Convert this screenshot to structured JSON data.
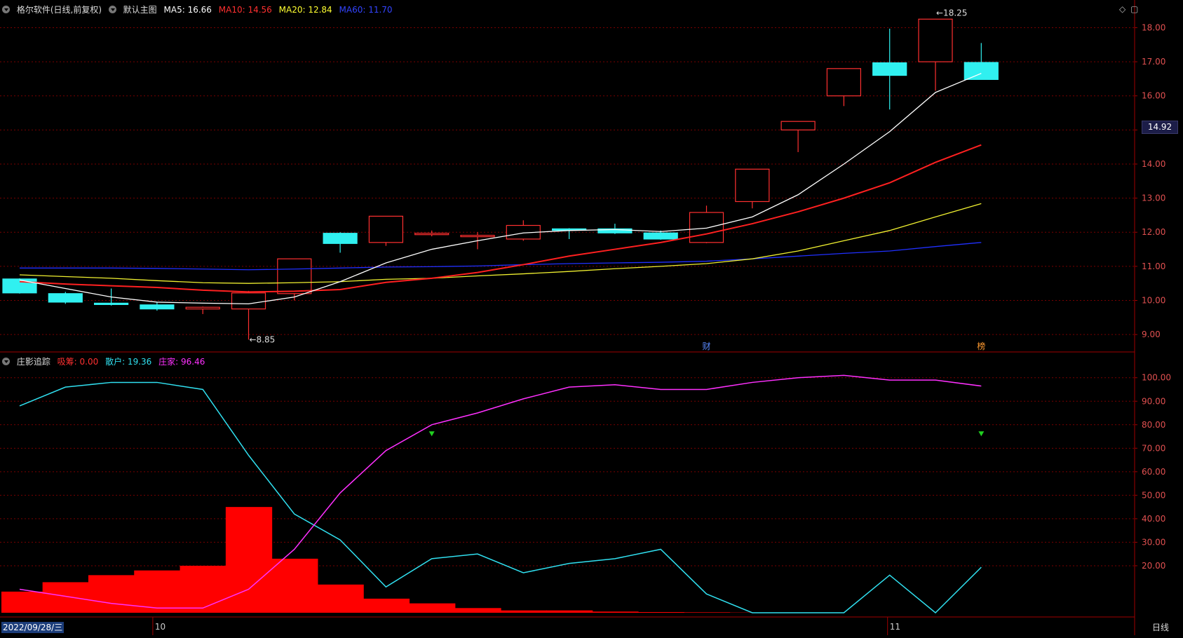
{
  "header_top": {
    "software": "格尔软件(日线,前复权)",
    "chart_name": "默认主图",
    "ma": [
      {
        "label": "MA5: 16.66",
        "color": "#ffffff"
      },
      {
        "label": "MA10: 14.56",
        "color": "#ff3030"
      },
      {
        "label": "MA20: 12.84",
        "color": "#ffff30"
      },
      {
        "label": "MA60: 11.70",
        "color": "#2233ff"
      }
    ]
  },
  "header_bottom": {
    "name": "庄影追踪",
    "items": [
      {
        "label": "吸筹: 0.00",
        "color": "#ff3030"
      },
      {
        "label": "散户: 19.36",
        "color": "#30e0f0"
      },
      {
        "label": "庄家: 96.46",
        "color": "#ff30ff"
      }
    ]
  },
  "current_price": "14.92",
  "date_label": "2022/09/28/三",
  "period_label": "日线",
  "month_marks": [
    "10",
    "11"
  ],
  "colors": {
    "up": "#ff3030",
    "down": "#30f0f0",
    "ma5": "#ffffff",
    "ma10": "#ff2020",
    "ma20": "#f0f030",
    "ma60": "#2030ff",
    "grid": "#7a0000",
    "retail": "#30e0f0",
    "banker": "#ff30ff",
    "absorb": "#ff0000",
    "signal": "#20d020"
  },
  "chart_data": [
    {
      "type": "candlestick",
      "ylim": [
        8.5,
        18.5
      ],
      "yticks": [
        "18.00",
        "17.00",
        "16.00",
        "15.00",
        "14.00",
        "13.00",
        "12.00",
        "11.00",
        "10.00",
        "9.00"
      ],
      "candles": [
        {
          "o": 10.63,
          "c": 10.22,
          "h": 10.65,
          "l": 10.2
        },
        {
          "o": 10.2,
          "c": 9.95,
          "h": 10.25,
          "l": 9.9
        },
        {
          "o": 9.92,
          "c": 9.88,
          "h": 10.35,
          "l": 9.85
        },
        {
          "o": 9.87,
          "c": 9.75,
          "h": 9.95,
          "l": 9.7
        },
        {
          "o": 9.75,
          "c": 9.8,
          "h": 9.82,
          "l": 9.6
        },
        {
          "o": 9.75,
          "c": 10.22,
          "h": 10.28,
          "l": 8.85
        },
        {
          "o": 10.2,
          "c": 11.22,
          "h": 11.22,
          "l": 10.0
        },
        {
          "o": 11.97,
          "c": 11.67,
          "h": 12.0,
          "l": 11.4
        },
        {
          "o": 11.7,
          "c": 12.47,
          "h": 12.47,
          "l": 11.6
        },
        {
          "o": 11.97,
          "c": 11.97,
          "h": 12.05,
          "l": 11.88
        },
        {
          "o": 11.9,
          "c": 11.91,
          "h": 12.0,
          "l": 11.5
        },
        {
          "o": 11.8,
          "c": 12.2,
          "h": 12.35,
          "l": 11.75
        },
        {
          "o": 12.1,
          "c": 12.08,
          "h": 12.12,
          "l": 11.8
        },
        {
          "o": 12.1,
          "c": 11.98,
          "h": 12.25,
          "l": 11.95
        },
        {
          "o": 11.98,
          "c": 11.8,
          "h": 12.05,
          "l": 11.78
        },
        {
          "o": 11.7,
          "c": 12.58,
          "h": 12.78,
          "l": 11.68
        },
        {
          "o": 12.9,
          "c": 13.85,
          "h": 13.85,
          "l": 12.7
        },
        {
          "o": 15.0,
          "c": 15.25,
          "h": 15.25,
          "l": 14.35
        },
        {
          "o": 16.0,
          "c": 16.8,
          "h": 16.8,
          "l": 15.7
        },
        {
          "o": 16.97,
          "c": 16.6,
          "h": 17.97,
          "l": 15.6
        },
        {
          "o": 17.0,
          "c": 18.25,
          "h": 18.25,
          "l": 16.15
        },
        {
          "o": 16.98,
          "c": 16.48,
          "h": 17.55,
          "l": 16.48
        }
      ],
      "ma5": [
        10.6,
        10.35,
        10.1,
        9.95,
        9.92,
        9.9,
        10.1,
        10.55,
        11.1,
        11.5,
        11.75,
        11.98,
        12.05,
        12.08,
        12.02,
        12.12,
        12.45,
        13.1,
        14.0,
        14.95,
        16.1,
        16.66
      ],
      "ma10": [
        10.55,
        10.48,
        10.43,
        10.38,
        10.3,
        10.25,
        10.27,
        10.32,
        10.53,
        10.65,
        10.82,
        11.05,
        11.3,
        11.5,
        11.7,
        11.95,
        12.25,
        12.6,
        13.0,
        13.45,
        14.05,
        14.56
      ],
      "ma20": [
        10.75,
        10.7,
        10.65,
        10.58,
        10.52,
        10.5,
        10.52,
        10.55,
        10.62,
        10.65,
        10.72,
        10.78,
        10.85,
        10.93,
        11.0,
        11.08,
        11.22,
        11.45,
        11.75,
        12.05,
        12.45,
        12.84
      ],
      "ma60": [
        10.95,
        10.95,
        10.95,
        10.94,
        10.92,
        10.9,
        10.92,
        10.95,
        10.98,
        10.99,
        11.01,
        11.05,
        11.08,
        11.1,
        11.12,
        11.15,
        11.22,
        11.3,
        11.38,
        11.45,
        11.58,
        11.7
      ],
      "annotations": [
        {
          "label": "8.85",
          "index": 5,
          "value": 8.85
        },
        {
          "label": "18.25",
          "index": 20,
          "value": 18.25
        }
      ],
      "event_marks": [
        {
          "label": "财",
          "index": 15,
          "color": "#5a8aff"
        },
        {
          "label": "榜",
          "index": 21,
          "color": "#ff9a30"
        }
      ]
    },
    {
      "type": "line",
      "ylim": [
        0,
        106
      ],
      "yticks": [
        "100.00",
        "90.00",
        "80.00",
        "70.00",
        "60.00",
        "50.00",
        "40.00",
        "30.00",
        "20.00"
      ],
      "series": [
        {
          "name": "散户",
          "values": [
            88,
            96,
            98,
            98,
            95,
            67,
            42,
            31,
            11,
            23,
            25,
            17,
            21,
            23,
            27,
            8,
            0,
            0,
            0,
            16,
            0,
            19.36
          ]
        },
        {
          "name": "庄家",
          "values": [
            10,
            7,
            4,
            2,
            2,
            10,
            27,
            51,
            69,
            80,
            85,
            91,
            96,
            97,
            95,
            95,
            98,
            100,
            101,
            99,
            99,
            96.46
          ]
        },
        {
          "name": "吸筹",
          "type": "step",
          "values": [
            9,
            13,
            16,
            18,
            20,
            45,
            23,
            12,
            6,
            4,
            2,
            1,
            1,
            0.5,
            0.3,
            0.2,
            0.1,
            0.1,
            0,
            0,
            0,
            0
          ]
        }
      ],
      "signals": [
        9,
        21
      ],
      "signal_level": 76
    }
  ]
}
